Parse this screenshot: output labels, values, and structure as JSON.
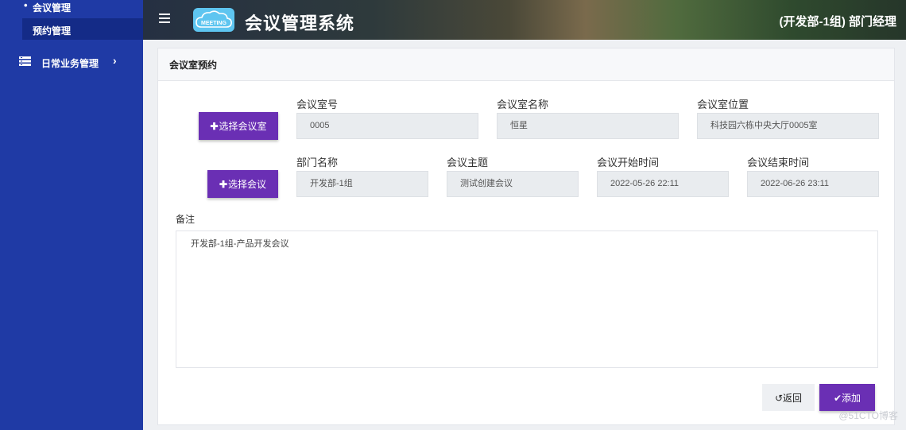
{
  "sidebar": {
    "meeting_mgmt": "会议管理",
    "booking_mgmt": "预约管理",
    "daily_business": "日常业务管理"
  },
  "header": {
    "logo_text": "MEETING",
    "system_title": "会议管理系统",
    "user_role": "(开发部-1组) 部门经理"
  },
  "panel": {
    "title": "会议室预约",
    "select_room_button": "选择会议室",
    "select_meeting_button": "选择会议",
    "room": {
      "number_label": "会议室号",
      "number_value": "0005",
      "name_label": "会议室名称",
      "name_value": "恒星",
      "location_label": "会议室位置",
      "location_value": "科技园六栋中央大厅0005室"
    },
    "meeting": {
      "dept_label": "部门名称",
      "dept_value": "开发部-1组",
      "topic_label": "会议主题",
      "topic_value": "测试创建会议",
      "start_label": "会议开始时间",
      "start_value": "2022-05-26 22:11",
      "end_label": "会议结束时间",
      "end_value": "2022-06-26 23:11"
    },
    "notes_label": "备注",
    "notes_value": "开发部-1组-产品开发会议",
    "back_button": "返回",
    "add_button": "添加"
  },
  "watermark": "@51CTO博客"
}
